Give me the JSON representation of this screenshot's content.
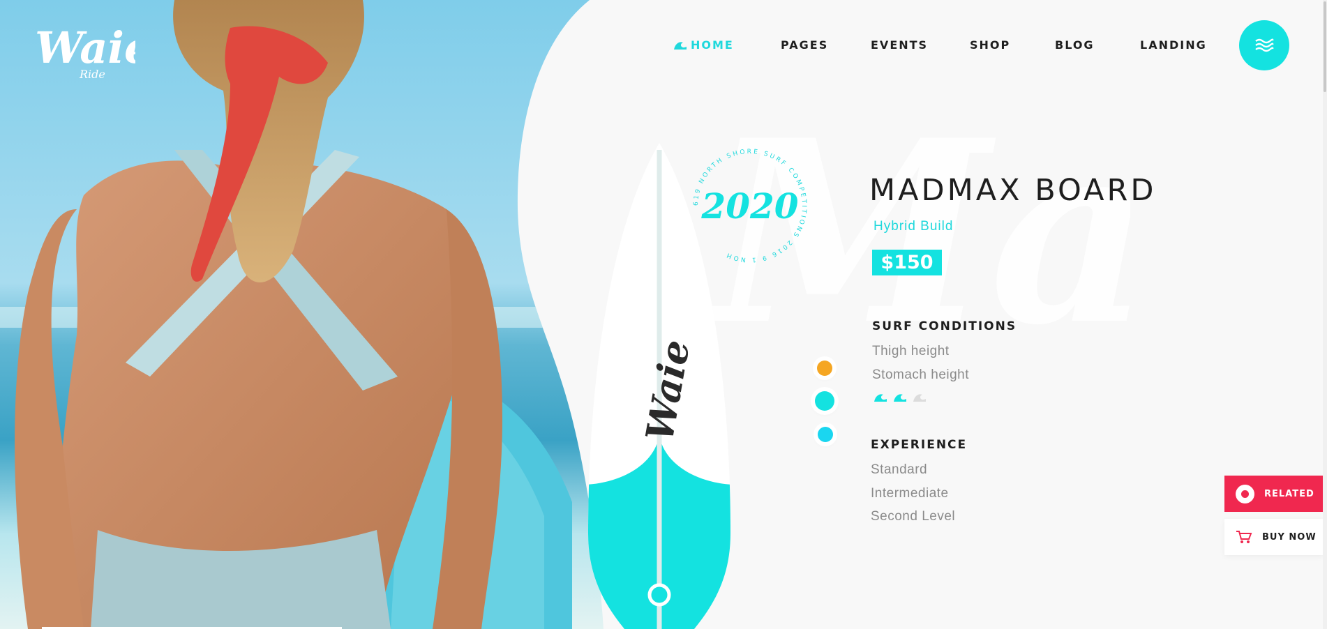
{
  "brand": {
    "logo_text": "Waie",
    "logo_sub": "Ride"
  },
  "nav": {
    "items": [
      {
        "label": "HOME",
        "active": true
      },
      {
        "label": "PAGES",
        "active": false
      },
      {
        "label": "EVENTS",
        "active": false
      },
      {
        "label": "SHOP",
        "active": false
      },
      {
        "label": "BLOG",
        "active": false
      },
      {
        "label": "LANDING",
        "active": false
      }
    ],
    "menu_icon": "hamburger-waves-icon"
  },
  "badge": {
    "year": "2020",
    "ring_text": "619 NORTH SHORE SURF COMPETITIONS 2016 9 1 NOH"
  },
  "watermark_text": "Mad",
  "product": {
    "title": "MADMAX BOARD",
    "subtitle": "Hybrid Build",
    "price": "$150",
    "surf_conditions": {
      "heading": "SURF CONDITIONS",
      "items": [
        "Thigh height",
        "Stomach height"
      ],
      "wave_rating": {
        "filled": 2,
        "total": 3
      }
    },
    "experience": {
      "heading": "EXPERIENCE",
      "items": [
        "Standard",
        "Intermediate",
        "Second Level"
      ]
    },
    "board_logo_text": "Waie"
  },
  "color_options": [
    {
      "color": "#f5a623",
      "selected": false
    },
    {
      "color": "#14e2e0",
      "selected": true
    },
    {
      "color": "#1ad6f0",
      "selected": false
    }
  ],
  "side_actions": {
    "related_label": "RELATED",
    "buy_label": "BUY NOW"
  },
  "colors": {
    "accent": "#14e2e0",
    "accent_text": "#1fd8dc",
    "related": "#f0284f",
    "dark": "#1e1e1e"
  }
}
